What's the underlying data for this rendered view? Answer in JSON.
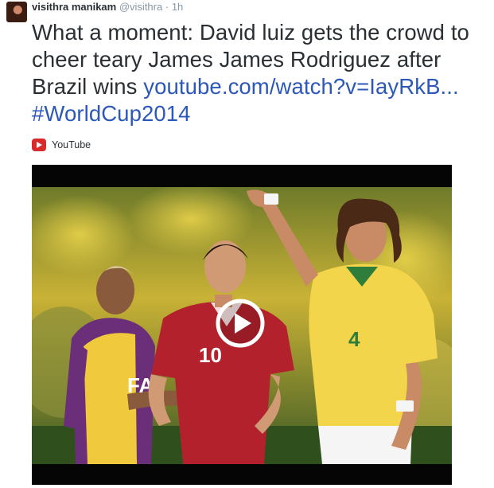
{
  "tweet": {
    "author_name": "visithra manikam",
    "author_handle": "@visithra",
    "separator": "·",
    "timestamp": "1h",
    "text_plain": "What a moment: David luiz gets the crowd to cheer teary James James Rodriguez after Brazil wins ",
    "link_text": "youtube.com/watch?v=IayRkB...",
    "hashtag": "#WorldCup2014"
  },
  "card": {
    "source_label": "YouTube",
    "source_icon": "youtube-icon",
    "play_icon": "play-icon",
    "jersey_10": "10",
    "jersey_4": "4",
    "sleeve_text": "FA"
  },
  "colors": {
    "link": "#2c58b8",
    "youtube_red": "#d92b2b",
    "brazil_yellow": "#f2d54a",
    "colombia_red": "#b3222c",
    "pitch_green": "#3f6b2a"
  }
}
